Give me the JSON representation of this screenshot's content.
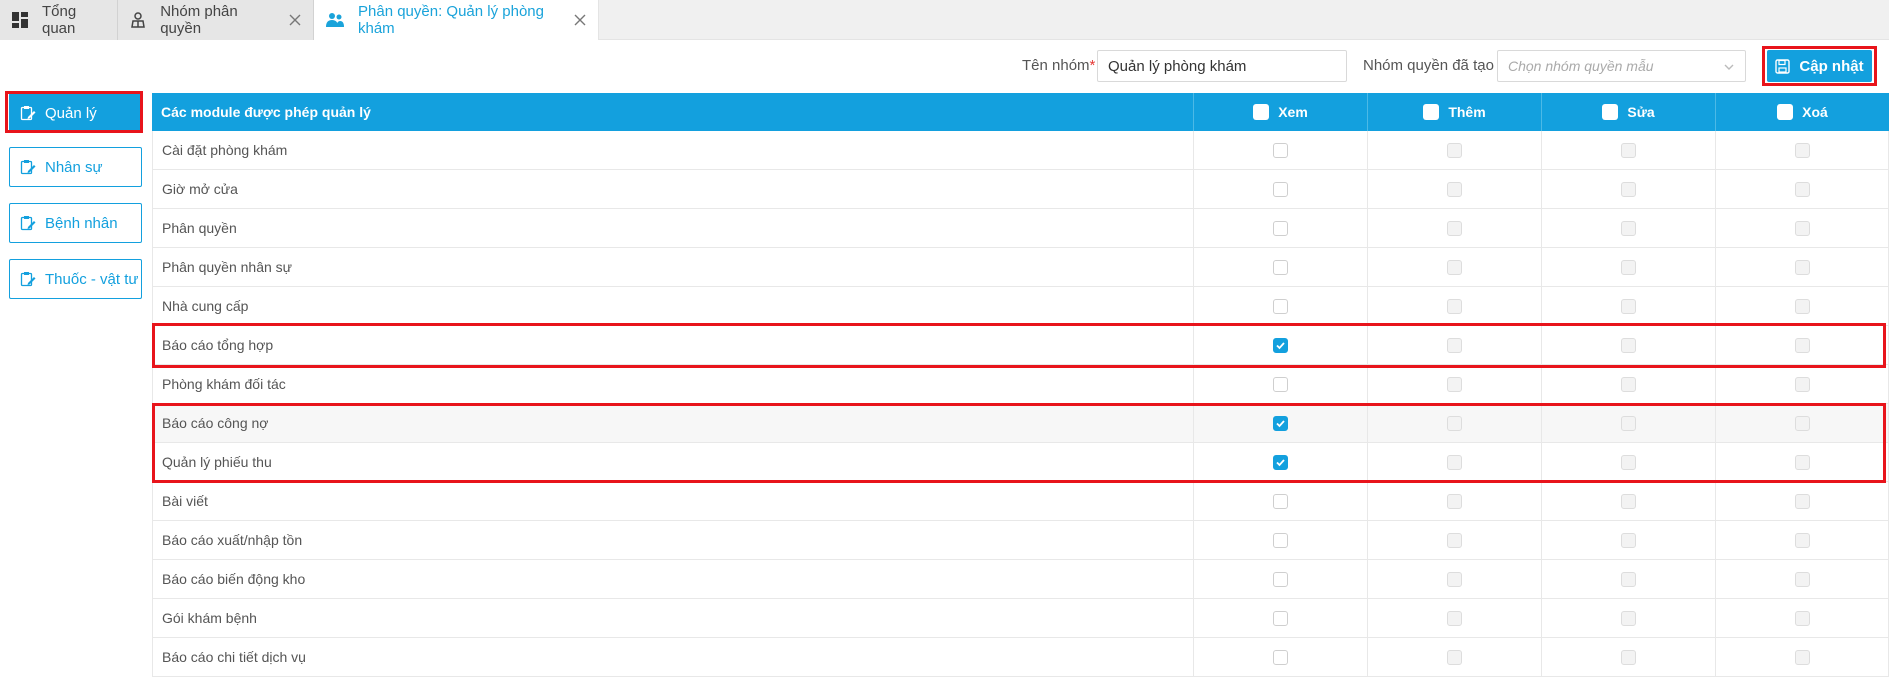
{
  "tabs": [
    {
      "label": "Tổng quan",
      "icon": "dashboard-icon",
      "closable": false,
      "active": false
    },
    {
      "label": "Nhóm phân quyền",
      "icon": "user-group-icon",
      "closable": true,
      "active": false
    },
    {
      "label": "Phân quyền: Quản lý phòng khám",
      "icon": "users-icon",
      "closable": true,
      "active": true
    }
  ],
  "toolbar": {
    "group_name_label": "Tên nhóm",
    "required_mark": "*",
    "group_name_value": "Quản lý phòng khám",
    "template_label": "Nhóm quyền đã tạo :",
    "template_placeholder": "Chọn nhóm quyền mẫu",
    "update_button": "Cập nhật"
  },
  "sidebar": {
    "items": [
      {
        "label": "Quản lý",
        "active": true
      },
      {
        "label": "Nhân sự",
        "active": false
      },
      {
        "label": "Bệnh nhân",
        "active": false
      },
      {
        "label": "Thuốc - vật tư",
        "active": false
      }
    ]
  },
  "table": {
    "header": {
      "module": "Các module được phép quản lý",
      "view": "Xem",
      "add": "Thêm",
      "edit": "Sửa",
      "delete": "Xoá"
    },
    "rows": [
      {
        "name": "Cài đặt phòng khám",
        "view": false
      },
      {
        "name": "Giờ mở cửa",
        "view": false
      },
      {
        "name": "Phân quyền",
        "view": false
      },
      {
        "name": "Phân quyền nhân sự",
        "view": false
      },
      {
        "name": "Nhà cung cấp",
        "view": false
      },
      {
        "name": "Báo cáo tổng hợp",
        "view": true
      },
      {
        "name": "Phòng khám đối tác",
        "view": false
      },
      {
        "name": "Báo cáo công nợ",
        "view": true
      },
      {
        "name": "Quản lý phiếu thu",
        "view": true
      },
      {
        "name": "Bài viết",
        "view": false
      },
      {
        "name": "Báo cáo xuất/nhập tồn",
        "view": false
      },
      {
        "name": "Báo cáo biến động kho",
        "view": false
      },
      {
        "name": "Gói khám bệnh",
        "view": false
      },
      {
        "name": "Báo cáo chi tiết dịch vụ",
        "view": false
      }
    ]
  },
  "colors": {
    "accent": "#13a0de",
    "highlight": "#e8141b"
  }
}
